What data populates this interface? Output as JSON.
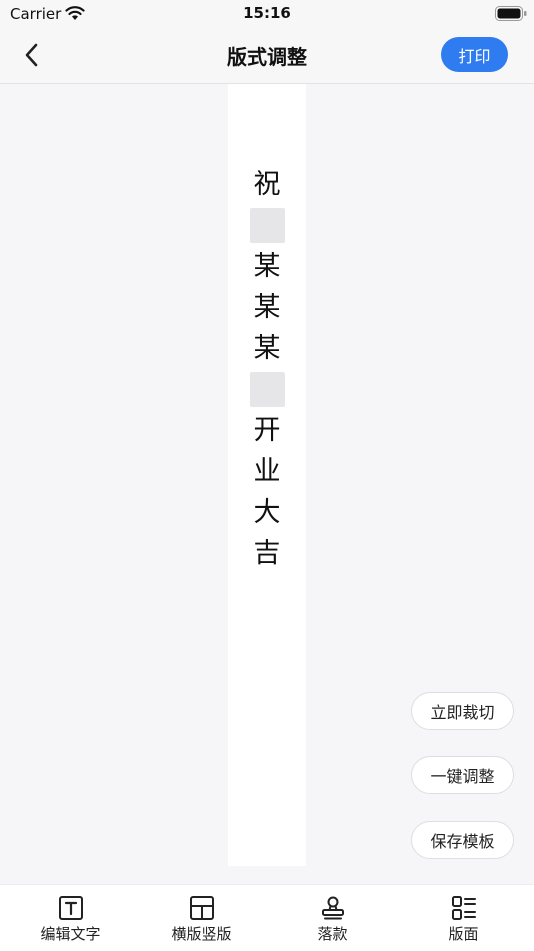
{
  "status_bar": {
    "carrier": "Carrier",
    "time": "15:16"
  },
  "nav": {
    "title": "版式调整",
    "print_label": "打印"
  },
  "canvas": {
    "items": [
      {
        "type": "char",
        "text": "祝"
      },
      {
        "type": "blank"
      },
      {
        "type": "char",
        "text": "某"
      },
      {
        "type": "char",
        "text": "某"
      },
      {
        "type": "char",
        "text": "某"
      },
      {
        "type": "blank"
      },
      {
        "type": "char",
        "text": "开"
      },
      {
        "type": "char",
        "text": "业"
      },
      {
        "type": "char",
        "text": "大"
      },
      {
        "type": "char",
        "text": "吉"
      }
    ]
  },
  "actions": {
    "crop_label": "立即裁切",
    "auto_adjust_label": "一键调整",
    "save_template_label": "保存模板"
  },
  "tabs": [
    {
      "label": "编辑文字",
      "icon": "text-edit-icon"
    },
    {
      "label": "横版竖版",
      "icon": "layout-icon"
    },
    {
      "label": "落款",
      "icon": "stamp-icon"
    },
    {
      "label": "版面",
      "icon": "list-layout-icon"
    }
  ]
}
